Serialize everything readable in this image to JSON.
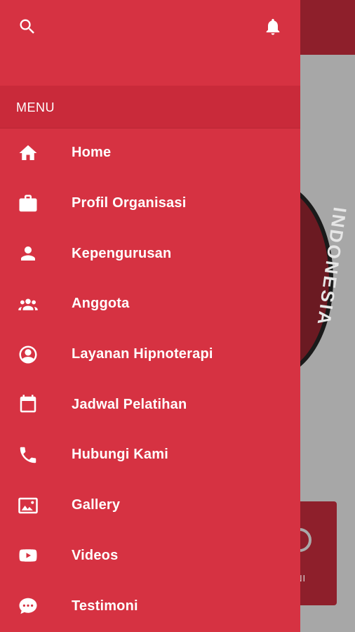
{
  "background": {
    "logo_text": "INDONESIA",
    "card_label": "ONI"
  },
  "header": {
    "search_icon": "search-icon",
    "notification_icon": "bell-icon"
  },
  "menu": {
    "section_title": "MENU",
    "items": [
      {
        "label": "Home",
        "icon": "home-icon"
      },
      {
        "label": "Profil Organisasi",
        "icon": "briefcase-icon"
      },
      {
        "label": "Kepengurusan",
        "icon": "person-icon"
      },
      {
        "label": "Anggota",
        "icon": "group-icon"
      },
      {
        "label": "Layanan Hipnoterapi",
        "icon": "account-circle-icon"
      },
      {
        "label": "Jadwal Pelatihan",
        "icon": "calendar-icon"
      },
      {
        "label": "Hubungi Kami",
        "icon": "phone-icon"
      },
      {
        "label": "Gallery",
        "icon": "image-icon"
      },
      {
        "label": "Videos",
        "icon": "youtube-icon"
      },
      {
        "label": "Testimoni",
        "icon": "chat-bubble-icon"
      }
    ]
  },
  "colors": {
    "drawer": "#d63242",
    "section": "#c92a3a",
    "scrim": "#a7a7a7"
  }
}
